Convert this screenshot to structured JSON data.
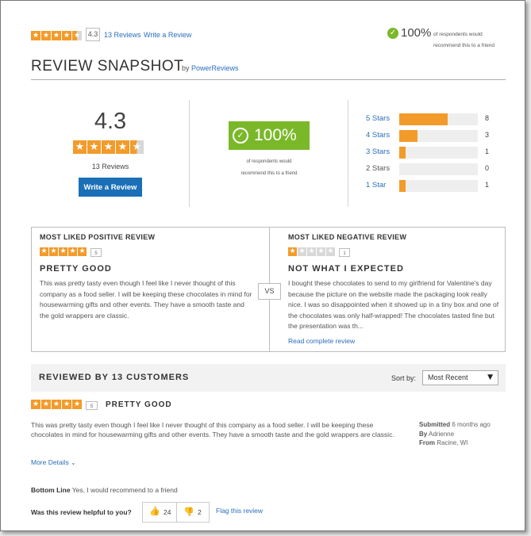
{
  "header": {
    "rating": "4.3",
    "rating_value": 4.3,
    "reviews_link": "13 Reviews",
    "write_link": "Write a Review",
    "recommend_pct": "100%",
    "recommend_text": "of respondents would recommend this to a friend"
  },
  "snapshot": {
    "title": "REVIEW SNAPSHOT",
    "by": "by",
    "by_link": "PowerReviews",
    "rating": "4.3",
    "rating_value": 4.3,
    "reviews_count": "13 Reviews",
    "write_button": "Write a Review",
    "recommend_pct": "100%",
    "recommend_line1": "of respondents would",
    "recommend_line2": "recommend this to a friend",
    "histogram": [
      {
        "label": "5 Stars",
        "count": "8",
        "value": 8,
        "link": true
      },
      {
        "label": "4 Stars",
        "count": "3",
        "value": 3,
        "link": true
      },
      {
        "label": "3 Stars",
        "count": "1",
        "value": 1,
        "link": true
      },
      {
        "label": "2 Stars",
        "count": "0",
        "value": 0,
        "link": false
      },
      {
        "label": "1 Star",
        "count": "1",
        "value": 1,
        "link": true
      }
    ],
    "histogram_max": 13
  },
  "faceoff": {
    "positive": {
      "heading": "MOST LIKED POSITIVE REVIEW",
      "rating_value": 5,
      "rating_label": "5",
      "title": "PRETTY GOOD",
      "body": "This was pretty tasty even though I feel like I never thought of this company as a food seller. I will be keeping these chocolates in mind for housewarming gifts and other events. They have a smooth taste and the gold wrappers are classic."
    },
    "vs": "VS",
    "negative": {
      "heading": "MOST LIKED NEGATIVE REVIEW",
      "rating_value": 1,
      "rating_label": "1",
      "title": "NOT WHAT I EXPECTED",
      "body": "I bought these chocolates to send to my girlfriend for Valentine's day because the picture on the website made the packaging look really nice. I was so disappointed when it showed up in a tiny box and one of the chocolates was only half-wrapped! The chocolates tasted fine but the presentation was th...",
      "read_link": "Read complete review"
    }
  },
  "reviews_header": {
    "title": "REVIEWED BY 13 CUSTOMERS",
    "sort_label": "Sort by:",
    "sort_value": "Most Recent"
  },
  "review": {
    "rating_value": 5,
    "rating_label": "5",
    "title": "PRETTY GOOD",
    "body": "This was pretty tasty even though I feel like I never thought of this company as a food seller. I will be keeping these chocolates in mind for housewarming gifts and other events. They have a smooth taste and the gold wrappers are classic.",
    "submitted_label": "Submitted",
    "submitted_value": "6 months ago",
    "by_label": "By",
    "by_value": "Adrienne",
    "from_label": "From",
    "from_value": "Racine, WI",
    "more_details": "More Details",
    "bottom_line_label": "Bottom Line",
    "bottom_line_value": "Yes, I would recommend to a friend",
    "helpful_label": "Was this review helpful to you?",
    "helpful_yes": "24",
    "helpful_no": "2",
    "flag_link": "Flag this review"
  },
  "colors": {
    "star": "#f39b2a",
    "star_empty": "#d8d8d8",
    "link": "#2a6ebb",
    "green": "#7ab829",
    "button": "#1b6fb7"
  }
}
